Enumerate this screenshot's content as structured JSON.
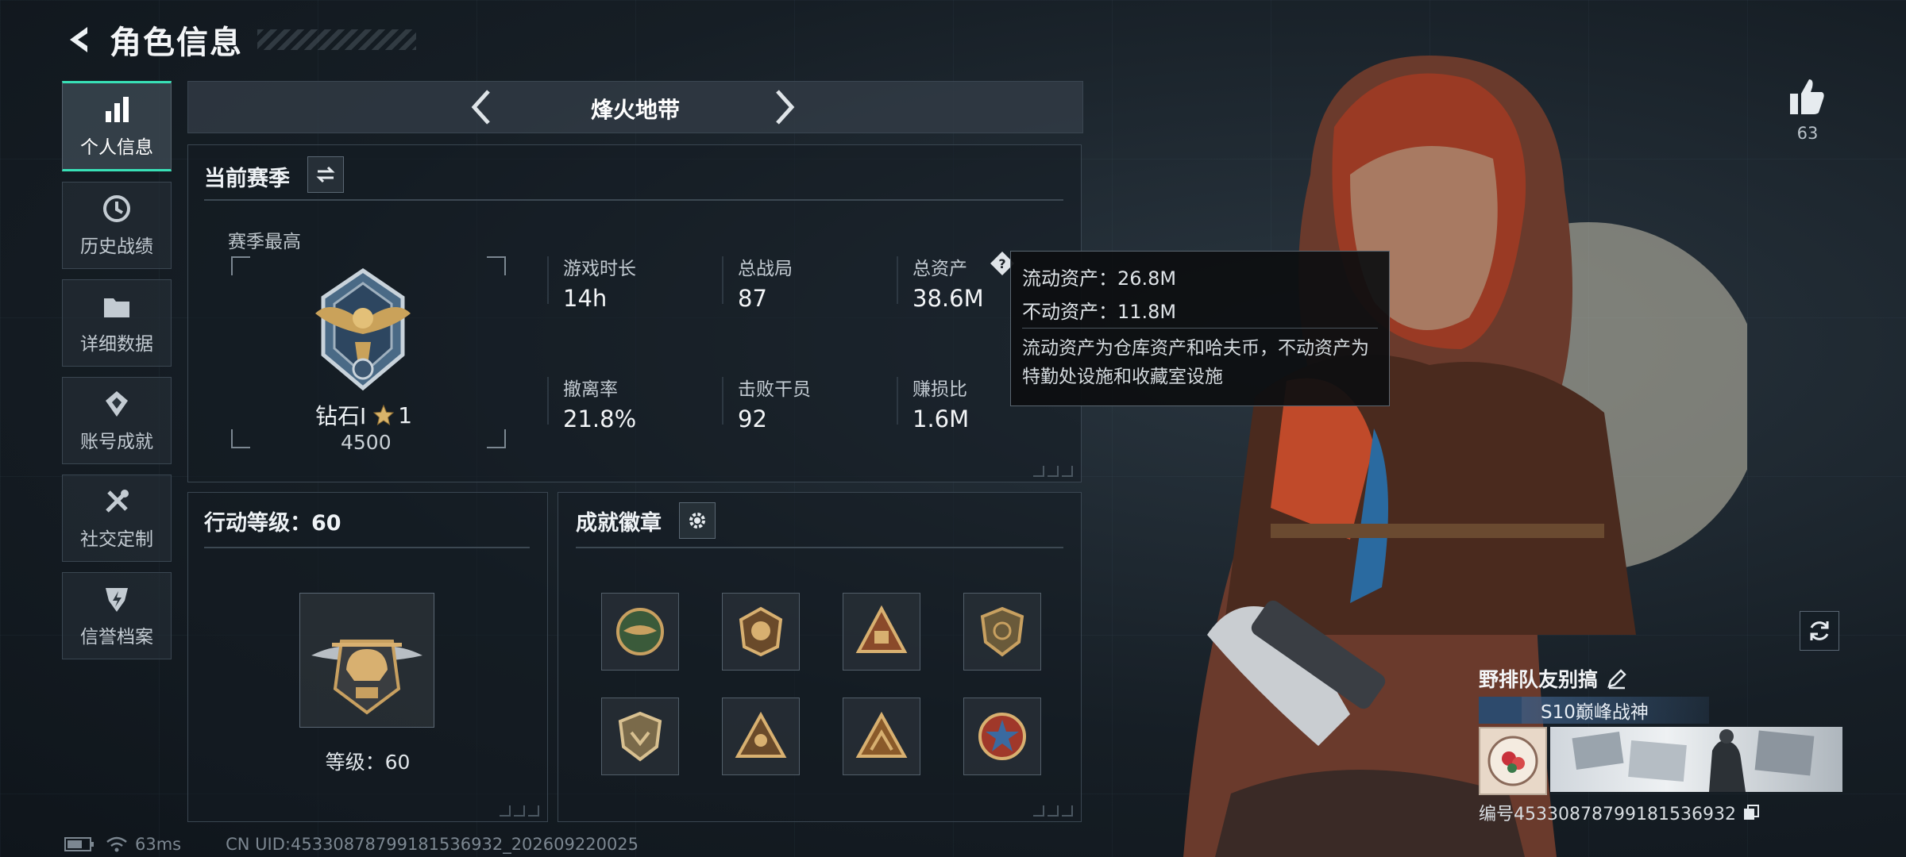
{
  "header": {
    "title": "角色信息"
  },
  "sidebar": {
    "items": [
      {
        "label": "个人信息",
        "icon": "bar-chart-icon",
        "active": true
      },
      {
        "label": "历史战绩",
        "icon": "history-clock-icon"
      },
      {
        "label": "详细数据",
        "icon": "folder-icon"
      },
      {
        "label": "账号成就",
        "icon": "achievement-icon"
      },
      {
        "label": "社交定制",
        "icon": "tools-icon"
      },
      {
        "label": "信誉档案",
        "icon": "credit-shield-icon"
      }
    ]
  },
  "mode": {
    "name": "烽火地带"
  },
  "season": {
    "title": "当前赛季",
    "best_label": "赛季最高",
    "rank_name": "钻石I",
    "rank_stars": "1",
    "rank_score": "4500",
    "stats": [
      {
        "label": "游戏时长",
        "value": "14h"
      },
      {
        "label": "总战局",
        "value": "87"
      },
      {
        "label": "总资产",
        "value": "38.6M"
      },
      {
        "label": "撤离率",
        "value": "21.8%"
      },
      {
        "label": "击败干员",
        "value": "92"
      },
      {
        "label": "赚损比",
        "value": "1.6M"
      }
    ]
  },
  "tooltip": {
    "liquid": "流动资产：26.8M",
    "fixed": "不动资产：11.8M",
    "desc": "流动资产为仓库资产和哈夫币，不动资产为特勤处设施和收藏室设施"
  },
  "level": {
    "title": "行动等级：60",
    "text": "等级：60"
  },
  "badges": {
    "title": "成就徽章",
    "count": 8
  },
  "footer": {
    "ping": "63ms",
    "uid": "CN UID:45330878799181536932_202609220025"
  },
  "character": {
    "likes": "63",
    "player_name": "野排队友别搞",
    "player_title": "S10巅峰战神",
    "player_id": "编号45330878799181536932"
  },
  "colors": {
    "accent": "#38e0b6",
    "gold": "#c8a060"
  }
}
